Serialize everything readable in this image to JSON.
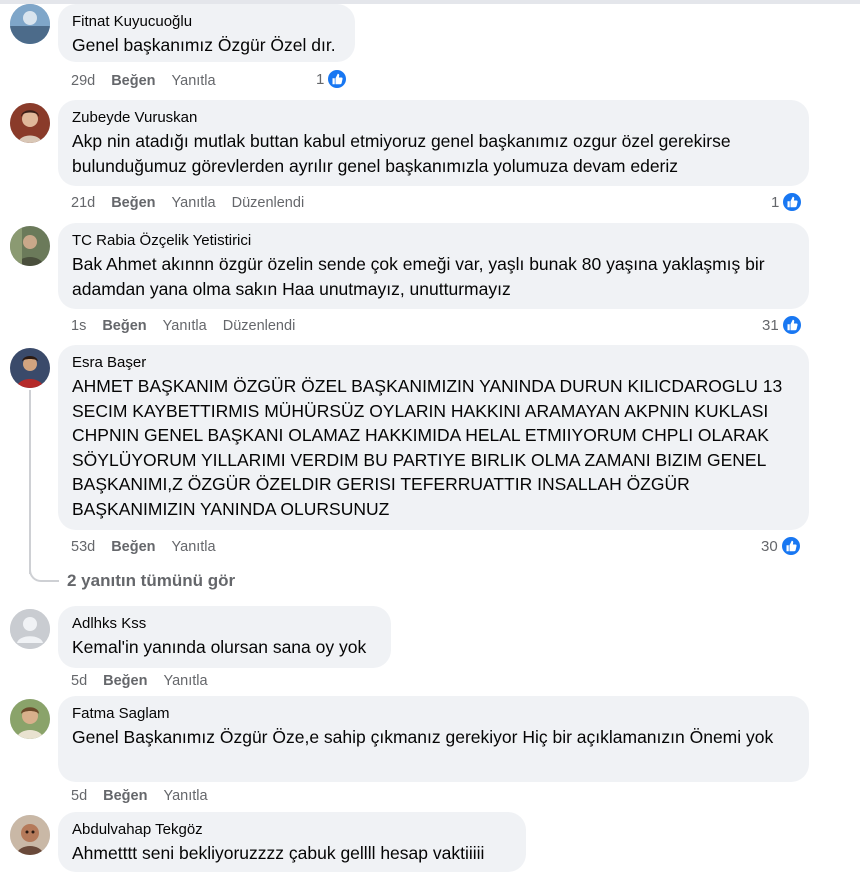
{
  "comments": [
    {
      "author": "Fitnat Kuyucuoğlu",
      "text": "Genel başkanımız Özgür Özel dır.",
      "time": "29d",
      "like_label": "Beğen",
      "reply_label": "Yanıtla",
      "edited_label": "",
      "reactions": "1"
    },
    {
      "author": "Zubeyde Vuruskan",
      "text": "Akp nin atadığı mutlak buttan kabul etmiyoruz genel başkanımız ozgur özel gerekirse bulunduğumuz görevlerden ayrılır genel başkanımızla yolumuza devam ederiz",
      "time": "21d",
      "like_label": "Beğen",
      "reply_label": "Yanıtla",
      "edited_label": "Düzenlendi",
      "reactions": "1"
    },
    {
      "author": "TC Rabia Özçelik Yetistirici",
      "text": "Bak Ahmet akınnn özgür özelin sende çok emeği var, yaşlı bunak 80 yaşına yaklaşmış bir adamdan yana olma sakın Haa unutmayız, unutturmayız",
      "time": "1s",
      "like_label": "Beğen",
      "reply_label": "Yanıtla",
      "edited_label": "Düzenlendi",
      "reactions": "31"
    },
    {
      "author": "Esra Başer",
      "text": "AHMET BAŞKANIM ÖZGÜR ÖZEL BAŞKANIMIZIN YANINDA DURUN KILICDAROGLU 13 SECIM KAYBETTIRMIS MÜHÜRSÜZ OYLARIN HAKKINI ARAMAYAN AKPNIN KUKLASI CHPNIN GENEL BAŞKANI OLAMAZ HAKKIMIDA HELAL ETMIIYORUM CHPLI OLARAK SÖYLÜYORUM YILLARIMI VERDIM BU PARTIYE BIRLIK OLMA ZAMANI BIZIM GENEL BAŞKANIMI,Z ÖZGÜR ÖZELDIR GERISI TEFERRUATTIR INSALLAH ÖZGÜR BAŞKANIMIZIN YANINDA OLURSUNUZ",
      "time": "53d",
      "like_label": "Beğen",
      "reply_label": "Yanıtla",
      "edited_label": "",
      "reactions": "30"
    },
    {
      "author": "Adlhks Kss",
      "text": "Kemal'in yanında olursan sana oy yok",
      "time": "5d",
      "like_label": "Beğen",
      "reply_label": "Yanıtla",
      "edited_label": "",
      "reactions": ""
    },
    {
      "author": "Fatma Saglam",
      "text": "Genel Başkanımız Özgür Öze,e sahip çıkmanız gerekiyor Hiç bir açıklamanızın Önemi yok",
      "time": "5d",
      "like_label": "Beğen",
      "reply_label": "Yanıtla",
      "edited_label": "",
      "reactions": ""
    },
    {
      "author": "Abdulvahap Tekgöz",
      "text": "Ahmetttt seni bekliyoruzzzz çabuk gellll hesap vaktiiiii",
      "time": "",
      "like_label": "",
      "reply_label": "",
      "edited_label": "",
      "reactions": ""
    }
  ],
  "view_replies_label": "2 yanıtın tümünü gör",
  "icons": {
    "like": "thumbs-up-icon",
    "avatar_default": "default-avatar-icon"
  },
  "colors": {
    "like_blue": "#1877f2",
    "bubble": "#f0f2f5",
    "meta_text": "#65676b"
  }
}
